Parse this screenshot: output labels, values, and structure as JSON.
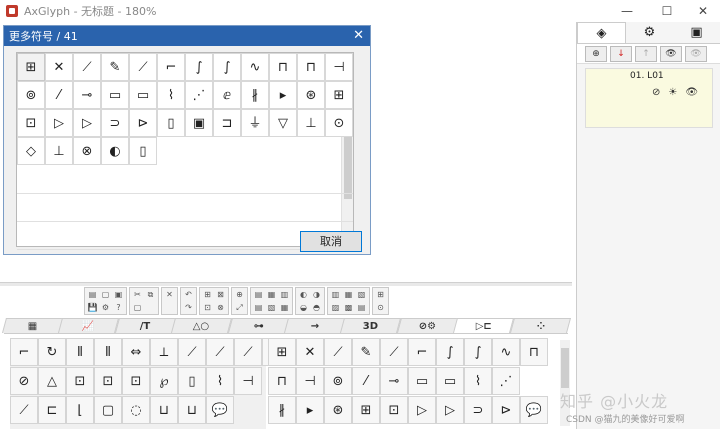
{
  "app": {
    "title": "AxGlyph - 无标题 - 180%",
    "minimize": "—",
    "maximize": "☐",
    "close": "✕"
  },
  "dialog": {
    "title": "更多符号 / 41",
    "close": "✕",
    "cancel": "取消",
    "scroll_up": "▲",
    "scroll_down": "▼",
    "rows": [
      [
        "⊞",
        "✕",
        "⟋",
        "✎",
        "⟋",
        "⌐",
        "∫",
        "∫",
        "∿",
        "⊓",
        "⊓",
        "⊣"
      ],
      [
        "⊚",
        "⁄",
        "⊸",
        "▭",
        "▭",
        "⌇",
        "⋰",
        "ⅇ",
        "∦",
        "▸",
        "⊛",
        "⊞"
      ],
      [
        "⊡",
        "▷",
        "▷",
        "⊃",
        "⊳",
        "▯",
        "▣",
        "⊐",
        "⏚",
        "▽",
        "⊥",
        "⊙"
      ],
      [
        "◇",
        "⊥",
        "⊗",
        "◐",
        "▯"
      ]
    ]
  },
  "right_panel": {
    "tabs": [
      "◈",
      "⚙",
      "▣"
    ],
    "tools": [
      "⊕",
      "↓",
      "↑",
      "👁",
      "👁"
    ],
    "layer_name": "01. L01",
    "layer_icons": [
      "⊘",
      "☀",
      "👁"
    ]
  },
  "toolbar": {
    "groups": [
      [
        "▤",
        "▢",
        "▣",
        "💾",
        "⚙",
        "?"
      ],
      [
        "✂",
        "⧉",
        "▢"
      ],
      [
        "✕"
      ],
      [
        "↶",
        "↷"
      ],
      [
        "⊞",
        "⊠",
        "⊡",
        "⊗"
      ],
      [
        "⊕",
        "⤢"
      ],
      [
        "▤",
        "▦",
        "▥",
        "▤",
        "▧",
        "▦"
      ],
      [
        "◐",
        "◑",
        "◒",
        "◓"
      ],
      [
        "▥",
        "▦",
        "▧",
        "▨",
        "▩",
        "▤"
      ],
      [
        "⊞",
        "⊙"
      ]
    ]
  },
  "tabs": [
    "▦",
    "📈",
    "/T",
    "△○",
    "⊶",
    "→",
    "3D",
    "⊘⚙",
    "▷⊏",
    "⁘"
  ],
  "left_palette": [
    [
      "⌐",
      "↻",
      "⫴",
      "⫴",
      "⇔",
      "⟂",
      "⟋",
      "⟋",
      "⟋",
      "💬"
    ],
    [
      "⊘",
      "△",
      "⊡",
      "⊡",
      "⊡",
      "℘",
      "▯",
      "⌇",
      "⊣",
      ""
    ],
    [
      "⟋",
      "⊏",
      "⌊",
      "▢",
      "◌",
      "⊔",
      "⊔",
      "💬",
      "",
      ""
    ]
  ],
  "right_palette": [
    [
      "⊞",
      "✕",
      "⟋",
      "✎",
      "⟋",
      "⌐",
      "∫",
      "∫",
      "∿",
      "⊓"
    ],
    [
      "⊓",
      "⊣",
      "⊚",
      "⁄",
      "⊸",
      "▭",
      "▭",
      "⌇",
      "⋰",
      ""
    ],
    [
      "∦",
      "▸",
      "⊛",
      "⊞",
      "⊡",
      "▷",
      "▷",
      "⊃",
      "⊳",
      "💬"
    ]
  ],
  "watermark": "知乎 @小火龙",
  "watermark2": "CSDN @猫九的美像好可爱啊"
}
